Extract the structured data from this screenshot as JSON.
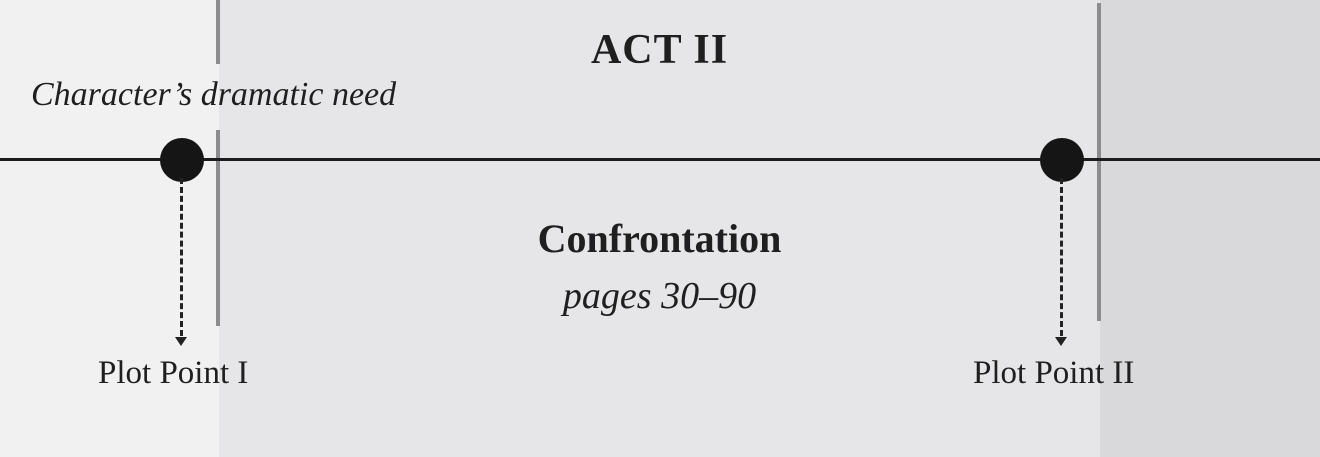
{
  "act": {
    "title": "ACT II"
  },
  "dramatic_need": "Character’s dramatic need",
  "section": {
    "title": "Confrontation",
    "pages": "pages 30–90"
  },
  "plot_points": [
    {
      "label": "Plot Point I"
    },
    {
      "label": "Plot Point II"
    }
  ],
  "colors": {
    "panel_left": "#f1f1f2",
    "panel_middle": "#e6e6e8",
    "panel_right": "#d9d9db",
    "divider": "#8c8c8e",
    "timeline": "#1c1c1c"
  }
}
